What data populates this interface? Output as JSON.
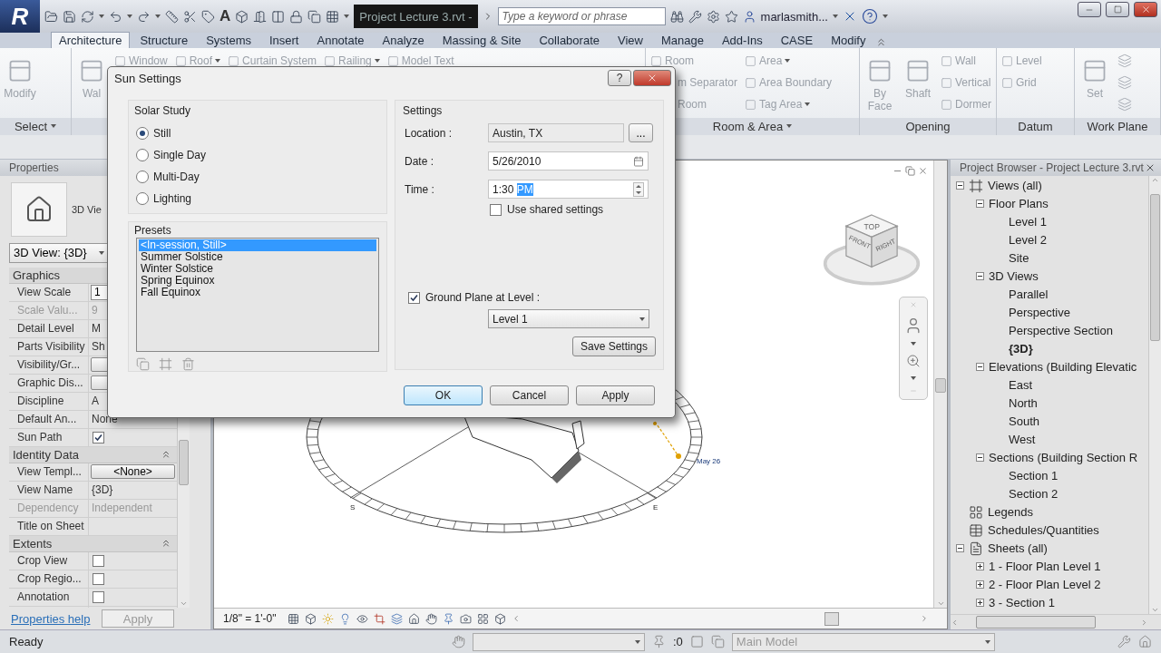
{
  "title_bar": {
    "app_logo": "R",
    "text_tool": "A",
    "document_title": "Project Lecture 3.rvt -",
    "search": {
      "placeholder": "Type a keyword or phrase"
    },
    "user": "marlasmith..."
  },
  "ribbon": {
    "disabled": true,
    "tabs": [
      {
        "label": "Architecture",
        "selected": true
      },
      {
        "label": "Structure",
        "selected": false
      },
      {
        "label": "Systems",
        "selected": false
      },
      {
        "label": "Insert",
        "selected": false
      },
      {
        "label": "Annotate",
        "selected": false
      },
      {
        "label": "Analyze",
        "selected": false
      },
      {
        "label": "Massing & Site",
        "selected": false
      },
      {
        "label": "Collaborate",
        "selected": false
      },
      {
        "label": "View",
        "selected": false
      },
      {
        "label": "Manage",
        "selected": false
      },
      {
        "label": "Add-Ins",
        "selected": false
      },
      {
        "label": "CASE",
        "selected": false
      },
      {
        "label": "Modify",
        "selected": false
      }
    ],
    "panels": [
      {
        "label": "Select",
        "dropdown": true,
        "columns": [
          [
            {
              "kind": "large",
              "label": "Modify"
            }
          ]
        ]
      },
      {
        "columns": [
          [
            {
              "kind": "large",
              "label": "Wal"
            }
          ],
          [
            {
              "kind": "small",
              "label": "Window"
            }
          ],
          [
            {
              "kind": "small",
              "label": "Roof",
              "dropdown": true
            }
          ],
          [
            {
              "kind": "small",
              "label": "Curtain System"
            }
          ],
          [
            {
              "kind": "small",
              "label": "Railing",
              "dropdown": true
            }
          ],
          [
            {
              "kind": "small",
              "label": "Model Text"
            }
          ]
        ]
      },
      {
        "label": "Room & Area",
        "dropdown": true,
        "columns": [
          [
            {
              "kind": "small",
              "label": "Room"
            },
            {
              "kind": "clipped",
              "label": "m Separator"
            },
            {
              "kind": "clipped",
              "label": "Room"
            }
          ],
          [
            {
              "kind": "small",
              "label": "Area",
              "dropdown": true
            },
            {
              "kind": "small",
              "label": "Area Boundary"
            },
            {
              "kind": "small",
              "label": "Tag Area",
              "dropdown": true
            }
          ]
        ]
      },
      {
        "label": "Opening",
        "columns": [
          [
            {
              "kind": "large",
              "label": "By Face"
            }
          ],
          [
            {
              "kind": "large",
              "label": "Shaft"
            }
          ],
          [
            {
              "kind": "small",
              "label": "Wall"
            },
            {
              "kind": "small",
              "label": "Vertical"
            },
            {
              "kind": "small",
              "label": "Dormer"
            }
          ]
        ]
      },
      {
        "label": "Datum",
        "columns": [
          [
            {
              "kind": "small",
              "label": "Level"
            },
            {
              "kind": "small",
              "label": "Grid"
            }
          ]
        ]
      },
      {
        "label": "Work Plane",
        "columns": [
          [
            {
              "kind": "large",
              "label": "Set"
            }
          ],
          [
            {
              "kind": "icon"
            },
            {
              "kind": "icon"
            },
            {
              "kind": "icon"
            }
          ]
        ]
      }
    ]
  },
  "properties": {
    "title": "Properties",
    "type_name": "3D Vie",
    "type_selector": "3D View: {3D}",
    "sections": [
      {
        "title": "Graphics",
        "rows": [
          {
            "label": "View Scale",
            "kind": "field",
            "value": "1",
            "disabled": false
          },
          {
            "label": "Scale Valu...",
            "kind": "text",
            "value": "9",
            "disabled": true
          },
          {
            "label": "Detail Level",
            "kind": "text",
            "value": "M",
            "disabled": false
          },
          {
            "label": "Parts Visibility",
            "kind": "text",
            "value": "Sh",
            "disabled": false
          },
          {
            "label": "Visibility/Gr...",
            "kind": "button",
            "disabled": false
          },
          {
            "label": "Graphic Dis...",
            "kind": "button",
            "disabled": false
          },
          {
            "label": "Discipline",
            "kind": "text",
            "value": "A",
            "disabled": false
          },
          {
            "label": "Default An...",
            "kind": "text",
            "value": "None",
            "disabled": false
          },
          {
            "label": "Sun Path",
            "kind": "checkbox",
            "checked": true,
            "disabled": false
          }
        ]
      },
      {
        "title": "Identity Data",
        "expanded": true,
        "rows": [
          {
            "label": "View Templ...",
            "kind": "button",
            "value": "<None>",
            "disabled": false
          },
          {
            "label": "View Name",
            "kind": "text",
            "value": "{3D}",
            "disabled": false
          },
          {
            "label": "Dependency",
            "kind": "text",
            "value": "Independent",
            "disabled": true
          },
          {
            "label": "Title on Sheet",
            "kind": "text",
            "disabled": false
          }
        ]
      },
      {
        "title": "Extents",
        "expanded": true,
        "rows": [
          {
            "label": "Crop View",
            "kind": "checkbox",
            "checked": false,
            "disabled": false
          },
          {
            "label": "Crop Regio...",
            "kind": "checkbox",
            "checked": false,
            "disabled": false
          },
          {
            "label": "Annotation",
            "kind": "checkbox",
            "checked": false,
            "disabled": false
          }
        ]
      }
    ],
    "help": "Properties help",
    "apply": {
      "label": "Apply",
      "disabled": true
    }
  },
  "view": {
    "scale": "1/8\" = 1'-0\"",
    "compass": {
      "south": "S",
      "east": "E"
    },
    "date_label": "May 26",
    "cube_faces": [
      "TOP",
      "FRONT",
      "RIGHT"
    ]
  },
  "sun_settings": {
    "title": "Sun Settings",
    "help": "?",
    "solar_study": {
      "title": "Solar Study",
      "options": [
        {
          "label": "Still",
          "selected": true
        },
        {
          "label": "Single Day",
          "selected": false
        },
        {
          "label": "Multi-Day",
          "selected": false
        },
        {
          "label": "Lighting",
          "selected": false
        }
      ]
    },
    "presets": {
      "title": "Presets",
      "items": [
        {
          "label": "<In-session, Still>",
          "selected": true
        },
        {
          "label": "Summer Solstice",
          "selected": false
        },
        {
          "label": "Winter Solstice",
          "selected": false
        },
        {
          "label": "Spring Equinox",
          "selected": false
        },
        {
          "label": "Fall Equinox",
          "selected": false
        }
      ]
    },
    "settings": {
      "title": "Settings",
      "location": {
        "label": "Location :",
        "value": "Austin, TX",
        "browse": "..."
      },
      "date": {
        "label": "Date :",
        "value": "5/26/2010"
      },
      "time": {
        "label": "Time :",
        "value": "1:30",
        "highlighted": "PM"
      },
      "use_shared": {
        "label": "Use shared settings",
        "checked": false
      },
      "ground_plane": {
        "label": "Ground Plane at Level :",
        "checked": true,
        "level": "Level 1"
      },
      "save": "Save Settings"
    },
    "buttons": [
      {
        "label": "OK",
        "default": true
      },
      {
        "label": "Cancel",
        "default": false
      },
      {
        "label": "Apply",
        "default": false
      }
    ]
  },
  "browser": {
    "title": "Project Browser - Project Lecture 3.rvt",
    "tree": [
      {
        "label": "Views (all)",
        "kind": "views",
        "expanded": true,
        "active": false,
        "children": [
          {
            "label": "Floor Plans",
            "expanded": true,
            "active": false,
            "children": [
              {
                "label": "Level 1",
                "active": false
              },
              {
                "label": "Level 2",
                "active": false
              },
              {
                "label": "Site",
                "active": false
              }
            ]
          },
          {
            "label": "3D Views",
            "expanded": true,
            "active": false,
            "children": [
              {
                "label": "Parallel",
                "active": false
              },
              {
                "label": "Perspective",
                "active": false
              },
              {
                "label": "Perspective Section",
                "active": false
              },
              {
                "label": "{3D}",
                "active": true
              }
            ]
          },
          {
            "label": "Elevations (Building Elevatic",
            "expanded": true,
            "active": false,
            "children": [
              {
                "label": "East",
                "active": false
              },
              {
                "label": "North",
                "active": false
              },
              {
                "label": "South",
                "active": false
              },
              {
                "label": "West",
                "active": false
              }
            ]
          },
          {
            "label": "Sections (Building Section R",
            "expanded": true,
            "active": false,
            "children": [
              {
                "label": "Section 1",
                "active": false
              },
              {
                "label": "Section 2",
                "active": false
              }
            ]
          }
        ]
      },
      {
        "label": "Legends",
        "kind": "legends",
        "active": false
      },
      {
        "label": "Schedules/Quantities",
        "kind": "schedules",
        "active": false
      },
      {
        "label": "Sheets (all)",
        "kind": "sheets",
        "expanded": true,
        "active": false,
        "children": [
          {
            "label": "1 - Floor Plan Level 1",
            "expanded": false,
            "active": false
          },
          {
            "label": "2 - Floor Plan Level 2",
            "expanded": false,
            "active": false
          },
          {
            "label": "3 - Section 1",
            "expanded": false,
            "active": false
          }
        ]
      }
    ]
  },
  "status_bar": {
    "text": "Ready",
    "selection_count": ":0",
    "model": "Main Model"
  }
}
